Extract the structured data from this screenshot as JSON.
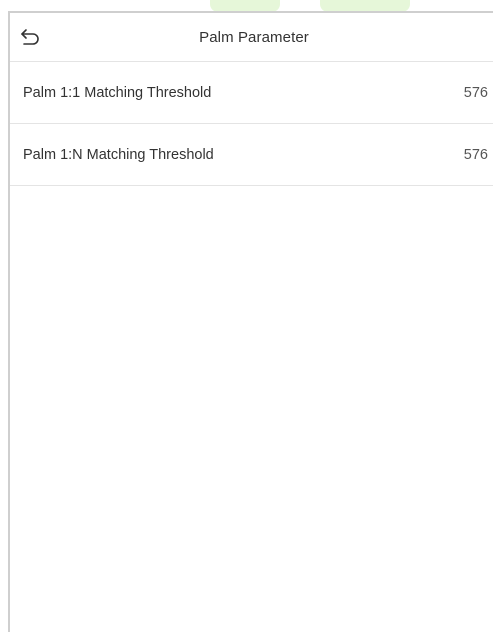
{
  "header": {
    "title": "Palm Parameter",
    "back_icon": "back-arrow-icon"
  },
  "settings": [
    {
      "label": "Palm 1:1 Matching Threshold",
      "value": "576"
    },
    {
      "label": "Palm 1:N Matching Threshold",
      "value": "576"
    }
  ],
  "colors": {
    "border": "#cfcfcf",
    "divider": "#e4e4e4",
    "text": "#333333",
    "watermark": "#e6f7d9"
  }
}
